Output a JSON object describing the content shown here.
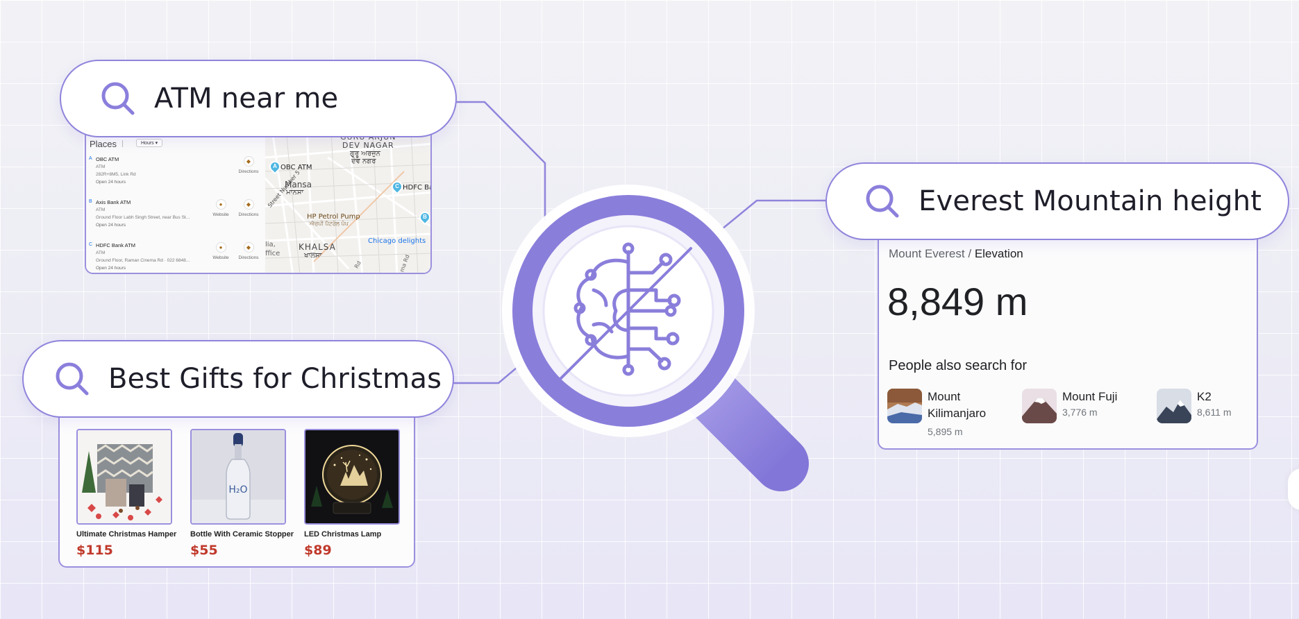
{
  "searches": {
    "atm": "ATM near me",
    "everest": "Everest Mountain height",
    "gifts": "Best Gifts for Christmas"
  },
  "atm_result": {
    "places_label": "Places",
    "hours_filter": "Hours ▾",
    "items": [
      {
        "letter": "A",
        "name": "OBC ATM",
        "type": "ATM",
        "address": "282R+8M5, Link Rd",
        "status": "Open 24 hours",
        "website": "",
        "directions": "Directions"
      },
      {
        "letter": "B",
        "name": "Axis Bank ATM",
        "type": "ATM",
        "address": "Ground Floor Labh Singh Street, near Bus St...",
        "status": "Open 24 hours",
        "website": "Website",
        "directions": "Directions"
      },
      {
        "letter": "C",
        "name": "HDFC Bank ATM",
        "type": "ATM",
        "address": "Ground Floor, Raman Cinema Rd · 022 6848...",
        "status": "Open 24 hours",
        "website": "Website",
        "directions": "Directions"
      }
    ],
    "map_labels": {
      "guru1": "GURU ARJUN",
      "guru2": "DEV NAGAR",
      "guru3": "ਗੁਰੂ ਅਰਜੁਨ",
      "guru4": "ਦੇਵ ਨਗਰ",
      "obc": "OBC ATM",
      "mansa1": "Mansa",
      "mansa2": "ਮਾਨਸਾ",
      "hdfc": "HDFC Ba",
      "street": "Street Number 5",
      "hp1": "HP Petrol Pump",
      "hp2": "ਐਚਪੀ ਪੈਟਰੋਲ ਪੰਪ",
      "chicago": "Chicago delights",
      "khalsa1": "KHALSA",
      "khalsa2": "ਖਾਲਸਾ",
      "ia": "lia,",
      "ffice": "ffice",
      "rd": "Rd",
      "ma": "ma Rd",
      "pin_a": "A",
      "pin_c": "C",
      "pin_b": "B"
    }
  },
  "everest_result": {
    "breadcrumb_parent": "Mount Everest",
    "breadcrumb_sep": "/",
    "breadcrumb_current": "Elevation",
    "value": "8,849 m",
    "people_also_search": "People also search for",
    "related": [
      {
        "name": "Mount Kilimanjaro",
        "height": "5,895 m"
      },
      {
        "name": "Mount Fuji",
        "height": "3,776 m"
      },
      {
        "name": "K2",
        "height": "8,611 m"
      }
    ]
  },
  "gift_result": {
    "products": [
      {
        "name": "Ultimate Christmas Hamper",
        "price": "$115"
      },
      {
        "name": "Bottle With Ceramic Stopper",
        "price": "$55"
      },
      {
        "name": "LED Christmas Lamp",
        "price": "$89"
      }
    ],
    "bottle_text": "H₂O"
  },
  "colors": {
    "accent": "#8b7fdc",
    "accent_light": "#a89ee6",
    "price_red": "#c0392b"
  },
  "icons": [
    "search-icon",
    "ai-brain-icon",
    "magnifier-icon",
    "directions-icon",
    "website-icon"
  ]
}
